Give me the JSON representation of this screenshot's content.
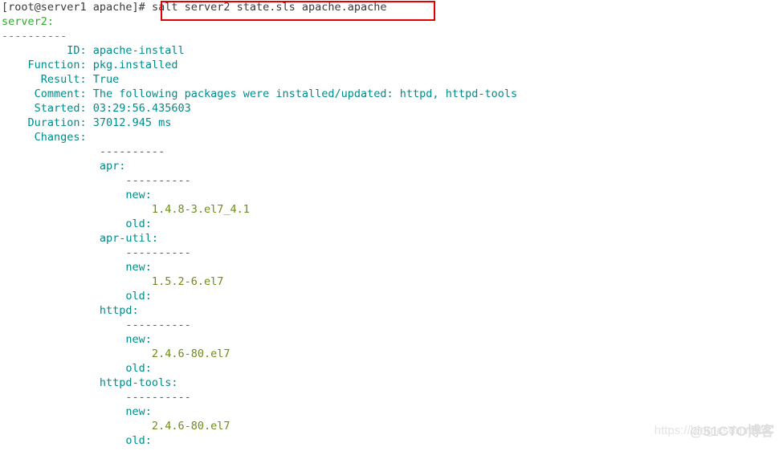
{
  "terminal": {
    "prompt": "[root@server1 apache]# ",
    "command": "salt server2 state.sls apache.apache",
    "highlight_color": "#e50000",
    "colors": {
      "prompt": "#3a3a3a",
      "minion": "#2faa2f",
      "label": "#008b8b",
      "version": "#6b8e14",
      "background": "#ffffff"
    },
    "minion": "server2:",
    "separator_top": "----------",
    "fields": [
      {
        "label": "          ID: ",
        "value": "apache-install"
      },
      {
        "label": "    Function: ",
        "value": "pkg.installed"
      },
      {
        "label": "      Result: ",
        "value": "True"
      },
      {
        "label": "     Comment: ",
        "value": "The following packages were installed/updated: httpd, httpd-tools"
      },
      {
        "label": "     Started: ",
        "value": "03:29:56.435603"
      },
      {
        "label": "    Duration: ",
        "value": "37012.945 ms"
      },
      {
        "label": "     Changes: ",
        "value": ""
      }
    ],
    "changes_separator": "               ----------",
    "packages": [
      {
        "name": "               apr:",
        "separator": "                   ----------",
        "new_label": "                   new:",
        "new_value": "                       1.4.8-3.el7_4.1",
        "old_label": "                   old:"
      },
      {
        "name": "               apr-util:",
        "separator": "                   ----------",
        "new_label": "                   new:",
        "new_value": "                       1.5.2-6.el7",
        "old_label": "                   old:"
      },
      {
        "name": "               httpd:",
        "separator": "                   ----------",
        "new_label": "                   new:",
        "new_value": "                       2.4.6-80.el7",
        "old_label": "                   old:"
      },
      {
        "name": "               httpd-tools:",
        "separator": "                   ----------",
        "new_label": "                   new:",
        "new_value": "                       2.4.6-80.el7",
        "old_label": "                   old:"
      }
    ],
    "watermark": "https://blog.csdn.net/C",
    "watermark_brand": "@51CTO博客"
  }
}
